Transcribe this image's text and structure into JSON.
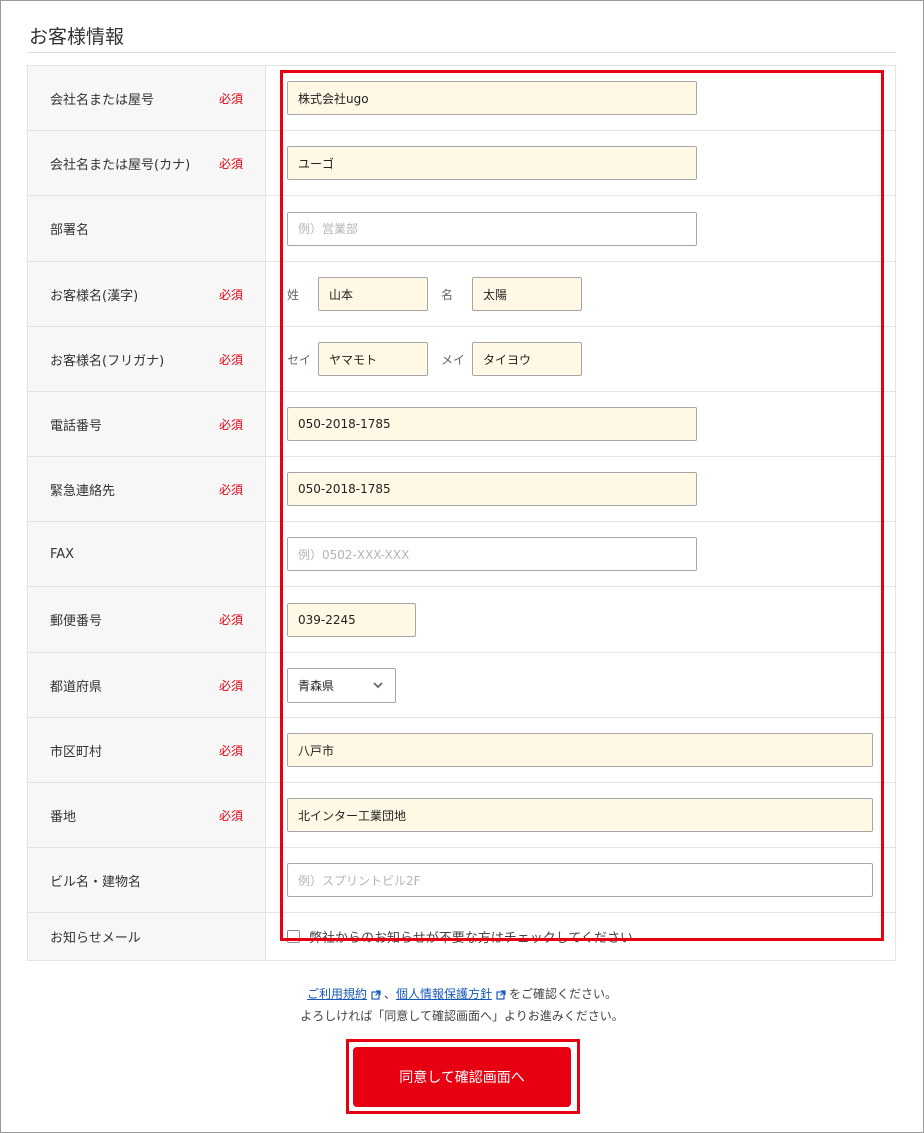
{
  "section_title": "お客様情報",
  "required_label": "必須",
  "fields": {
    "company": {
      "label": "会社名または屋号",
      "value": "株式会社ugo"
    },
    "company_kana": {
      "label": "会社名または屋号(カナ)",
      "value": "ユーゴ"
    },
    "department": {
      "label": "部署名",
      "placeholder": "例）営業部"
    },
    "name_kanji": {
      "label": "お客様名(漢字)",
      "last_label": "姓",
      "last_value": "山本",
      "first_label": "名",
      "first_value": "太陽"
    },
    "name_kana": {
      "label": "お客様名(フリガナ)",
      "last_label": "セイ",
      "last_value": "ヤマモト",
      "first_label": "メイ",
      "first_value": "タイヨウ"
    },
    "phone": {
      "label": "電話番号",
      "value": "050-2018-1785"
    },
    "emergency": {
      "label": "緊急連絡先",
      "value": "050-2018-1785"
    },
    "fax": {
      "label": "FAX",
      "placeholder": "例）0502-XXX-XXX"
    },
    "postal": {
      "label": "郵便番号",
      "value": "039-2245"
    },
    "prefecture": {
      "label": "都道府県",
      "selected": "青森県"
    },
    "city": {
      "label": "市区町村",
      "value": "八戸市"
    },
    "address": {
      "label": "番地",
      "value": "北インター工業団地"
    },
    "building": {
      "label": "ビル名・建物名",
      "placeholder": "例）スプリントビル2F"
    },
    "newsletter": {
      "label": "お知らせメール",
      "checkbox_text": "弊社からのお知らせが不要な方はチェックしてください"
    }
  },
  "notice": {
    "terms_link": "ご利用規約",
    "separator": "、",
    "privacy_link": "個人情報保護方針",
    "line1_suffix": "をご確認ください。",
    "line2": "よろしければ「同意して確認画面へ」よりお進みください。"
  },
  "submit_label": "同意して確認画面へ",
  "colors": {
    "accent": "#e60012",
    "input_fill": "#fff8e5",
    "link": "#1a5bb8"
  },
  "icons": {
    "select": "chevron-down-icon",
    "external": "external-link-icon"
  }
}
